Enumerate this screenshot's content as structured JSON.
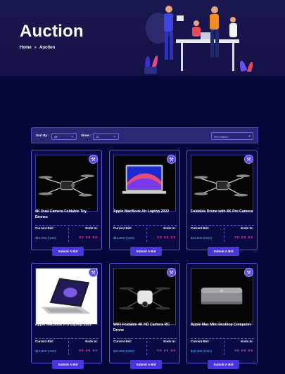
{
  "hero": {
    "title": "Auction",
    "breadcrumb": {
      "home": "Home",
      "separator": "»",
      "current": "Auction"
    }
  },
  "toolbar": {
    "sort_label": "Sort By :",
    "sort_value": "All",
    "show_label": "Show :",
    "show_value": "12",
    "search_placeholder": "Item Name..."
  },
  "cards": [
    {
      "title": "4K Dual Camera Foldable Toy Drones",
      "bid_label": "Current Bid:",
      "bid_value": "$14,750 (USD)",
      "ends_label": "Ends In:",
      "ends_value": "00 00 00",
      "button": "Submit A Bid",
      "image": "drone"
    },
    {
      "title": "Apple MacBook Air Laptop 2022",
      "bid_label": "Current Bid:",
      "bid_value": "$13,950 (USD)",
      "ends_label": "Ends In:",
      "ends_value": "00 00 00",
      "button": "Submit A Bid",
      "image": "macbook-air"
    },
    {
      "title": "Foldable Drone with 4K Pro Camera",
      "bid_label": "Current Bid:",
      "bid_value": "$21,500 (USD)",
      "ends_label": "Ends In:",
      "ends_value": "00 00 00",
      "button": "Submit A Bid",
      "image": "drone"
    },
    {
      "title": "Apple Macbook Pro Laptop 2022",
      "bid_label": "Current Bid:",
      "bid_value": "$13,500 (USD)",
      "ends_label": "Ends In:",
      "ends_value": "00 00 00",
      "button": "Submit A Bid",
      "image": "macbook-pro"
    },
    {
      "title": "WiFi Foldable 4K HD Camera RC Drone",
      "bid_label": "Current Bid:",
      "bid_value": "$20,650 (USD)",
      "ends_label": "Ends In:",
      "ends_value": "00 00 00",
      "button": "Submit A Bid",
      "image": "drone-white"
    },
    {
      "title": "Apple Mac Mini Desktop Computer",
      "bid_label": "Current Bid:",
      "bid_value": "$10,200 (USD)",
      "ends_label": "Ends In:",
      "ends_value": "00 00 00",
      "button": "Submit A Bid",
      "image": "mac-mini"
    }
  ],
  "colors": {
    "background": "#05063a",
    "accent": "#4a35d8",
    "bid_value": "#5eb3ff",
    "timer": "#ff3da6"
  },
  "icons": {
    "bid_badge": "gavel-icon",
    "search": "search-icon",
    "select": "chevron-down-icon"
  }
}
